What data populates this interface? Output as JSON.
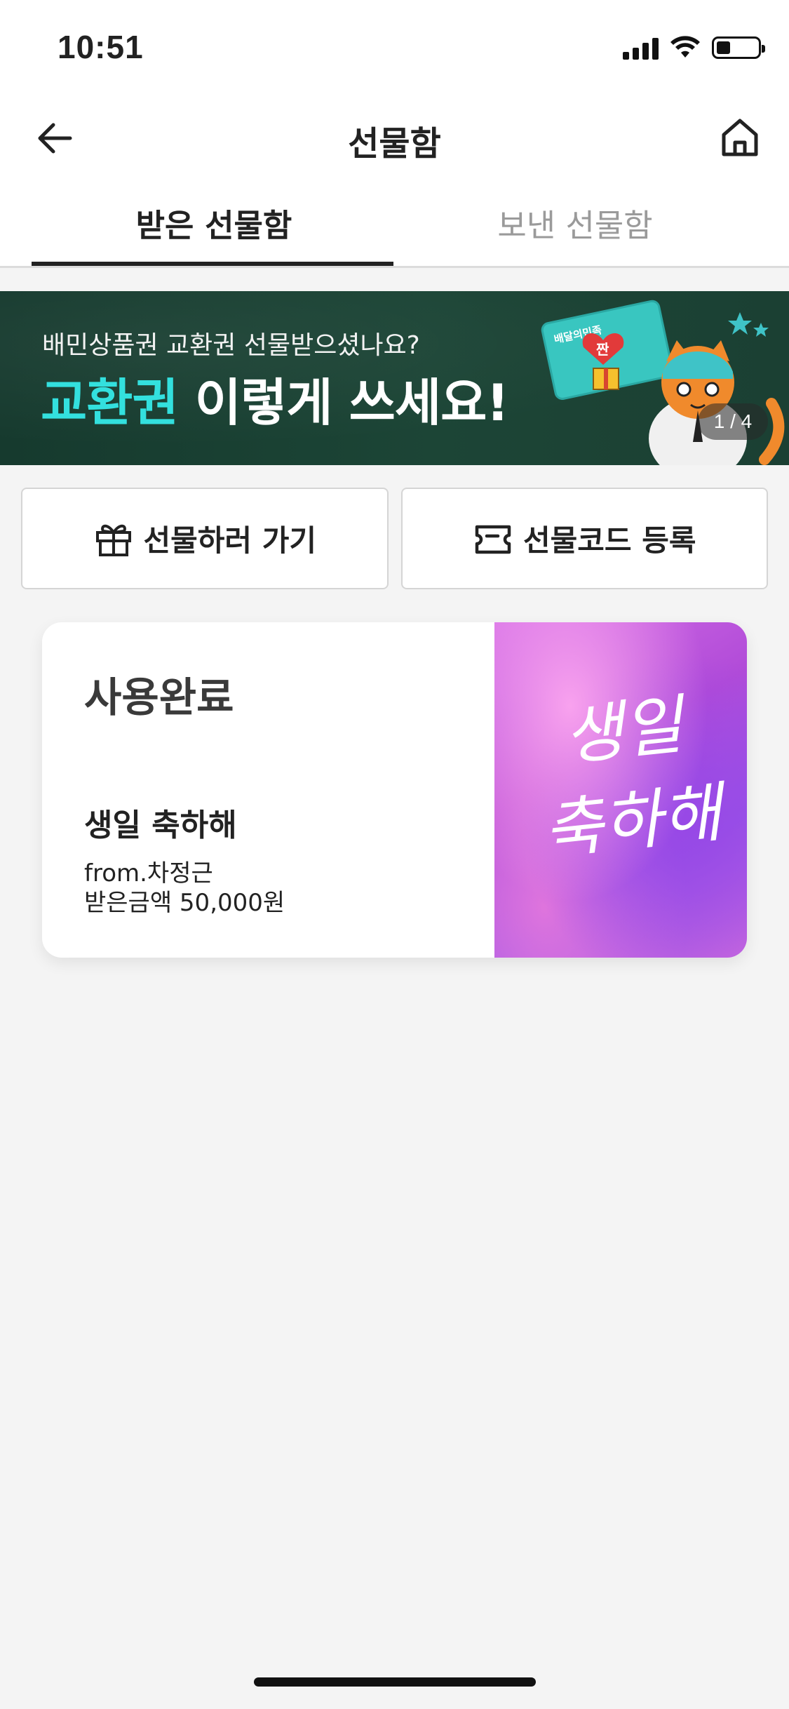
{
  "status_bar": {
    "time": "10:51",
    "battery_level": 0.3
  },
  "header": {
    "title": "선물함"
  },
  "tabs": [
    {
      "label": "받은 선물함",
      "active": true
    },
    {
      "label": "보낸 선물함",
      "active": false
    }
  ],
  "banner": {
    "subtitle": "배민상품권 교환권 선물받으셨나요?",
    "headline_accent": "교환권",
    "headline_rest": " 이렇게 쓰세요!",
    "counter": "1 / 4",
    "card_label": "배달의민족",
    "sticker_label": "짠"
  },
  "actions": {
    "send_gift": "선물하러 가기",
    "register_code": "선물코드 등록"
  },
  "gift_card": {
    "status": "사용완료",
    "title": "생일 축하해",
    "from": "from.차정근",
    "amount": "받은금액 50,000원",
    "image_text": "생일 축하해"
  },
  "colors": {
    "accent": "#33e0de",
    "banner_bg": "#1c4536",
    "page_bg": "#f4f4f4"
  }
}
